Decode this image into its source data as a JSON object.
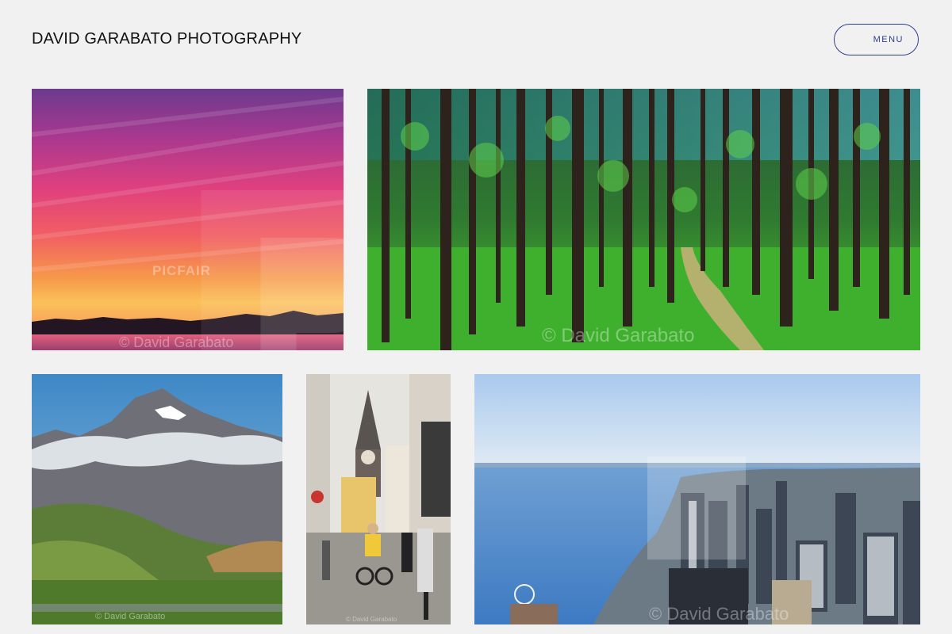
{
  "header": {
    "site_title": "DAVID GARABATO PHOTOGRAPHY",
    "menu_label": "MENU"
  },
  "gallery": {
    "photos": [
      {
        "subject": "sunset",
        "watermark": "© David Garabato",
        "overlay_text": "PICFAIR"
      },
      {
        "subject": "forest",
        "watermark": "© David Garabato"
      },
      {
        "subject": "mountain",
        "watermark": "© David Garabato"
      },
      {
        "subject": "street",
        "watermark": "© David Garabato"
      },
      {
        "subject": "city",
        "watermark": "© David Garabato"
      }
    ]
  },
  "colors": {
    "background": "#f1f1f1",
    "accent": "#2b3f8f",
    "title": "#111111"
  }
}
